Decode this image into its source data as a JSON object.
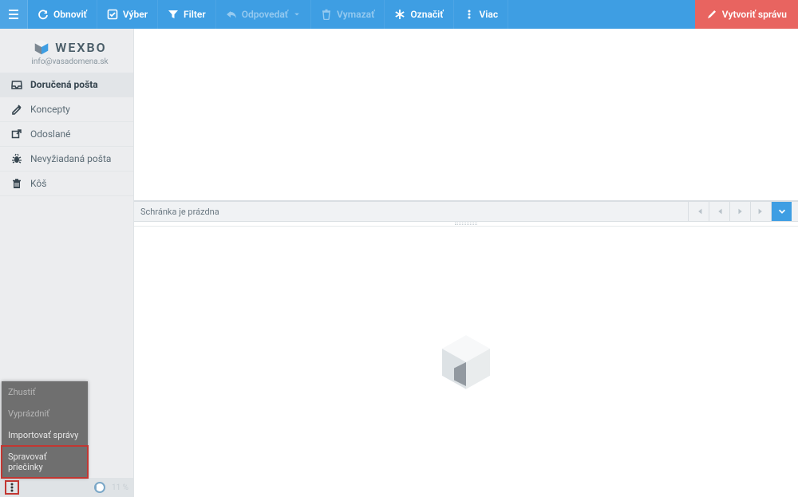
{
  "toolbar": {
    "menu": "≡",
    "buttons": [
      {
        "key": "refresh",
        "label": "Obnoviť",
        "disabled": false,
        "icon": "refresh"
      },
      {
        "key": "select",
        "label": "Výber",
        "disabled": false,
        "icon": "check-square"
      },
      {
        "key": "filter",
        "label": "Filter",
        "disabled": false,
        "icon": "funnel"
      },
      {
        "key": "reply",
        "label": "Odpovedať",
        "disabled": true,
        "icon": "reply",
        "caret": true
      },
      {
        "key": "delete",
        "label": "Vymazať",
        "disabled": true,
        "icon": "trash"
      },
      {
        "key": "mark",
        "label": "Označiť",
        "disabled": false,
        "icon": "asterisk"
      },
      {
        "key": "more",
        "label": "Viac",
        "disabled": false,
        "icon": "kebab"
      }
    ],
    "compose": {
      "label": "Vytvoriť správu",
      "icon": "pencil"
    }
  },
  "brand": {
    "name": "WEXBO",
    "subtitle": "info@vasadomena.sk"
  },
  "folders": [
    {
      "key": "inbox",
      "label": "Doručená pošta",
      "icon": "inbox",
      "active": true
    },
    {
      "key": "drafts",
      "label": "Koncepty",
      "icon": "edit",
      "active": false
    },
    {
      "key": "sent",
      "label": "Odoslané",
      "icon": "external",
      "active": false
    },
    {
      "key": "spam",
      "label": "Nevyžiadaná pošta",
      "icon": "bug",
      "active": false
    },
    {
      "key": "trash",
      "label": "Kôš",
      "icon": "bin",
      "active": false
    }
  ],
  "contextMenu": {
    "items": [
      {
        "key": "compact",
        "label": "Zhustiť",
        "disabled": true,
        "highlight": false
      },
      {
        "key": "empty",
        "label": "Vyprázdniť",
        "disabled": true,
        "highlight": false
      },
      {
        "key": "import",
        "label": "Importovať správy",
        "disabled": false,
        "highlight": false
      },
      {
        "key": "manage",
        "label": "Spravovať priečinky",
        "disabled": false,
        "highlight": true
      }
    ]
  },
  "quota": {
    "text": "11 %"
  },
  "list": {
    "emptyText": "Schránka je prázdna"
  },
  "pager": {
    "first": "⏮",
    "prev": "◀",
    "next": "▶",
    "last": "⏭",
    "expand": "⌄"
  }
}
